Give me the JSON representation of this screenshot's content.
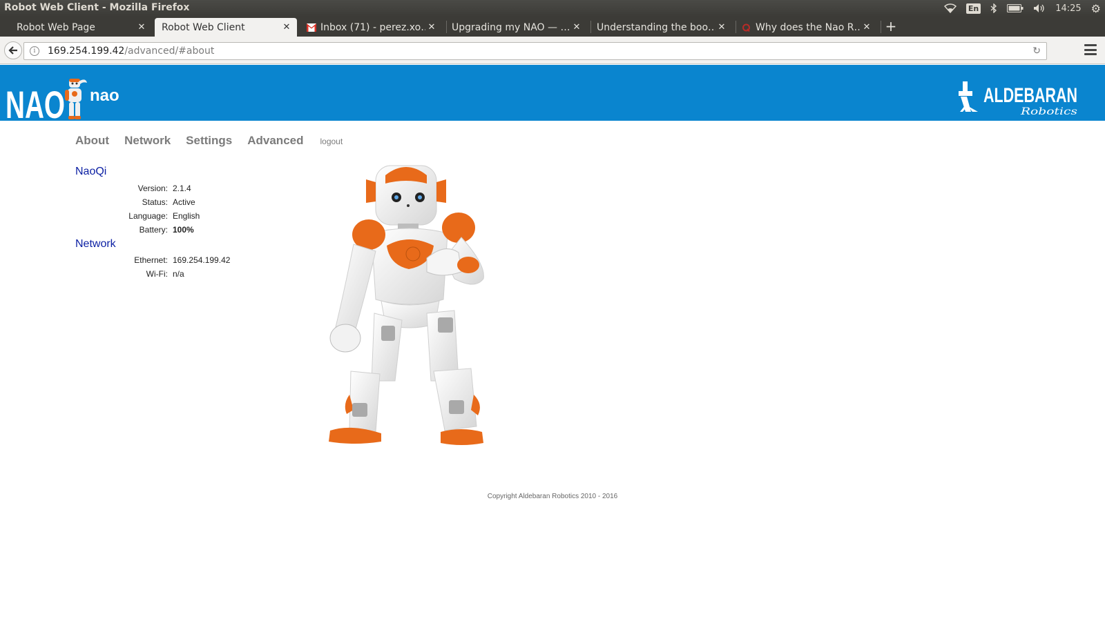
{
  "window": {
    "title": "Robot Web Client - Mozilla Firefox",
    "tray": {
      "lang": "En",
      "time": "14:25"
    }
  },
  "tabs": [
    {
      "label": "Robot Web Page",
      "active": false
    },
    {
      "label": "Robot Web Client",
      "active": true
    },
    {
      "label": "Inbox (71) - perez.xo…",
      "active": false
    },
    {
      "label": "Upgrading my NAO — …",
      "active": false
    },
    {
      "label": "Understanding the boo…",
      "active": false
    },
    {
      "label": "Why does the Nao R…",
      "active": false
    }
  ],
  "address_bar": {
    "host": "169.254.199.42",
    "path": "/advanced/#about"
  },
  "header": {
    "logo_text": "NAO",
    "robot_name": "nao",
    "brand": "ALDEBARAN",
    "brand_sub": "Robotics"
  },
  "nav": {
    "items": [
      "About",
      "Network",
      "Settings",
      "Advanced"
    ],
    "logout": "logout"
  },
  "naoqi": {
    "title": "NaoQi",
    "rows": [
      {
        "label": "Version:",
        "value": "2.1.4"
      },
      {
        "label": "Status:",
        "value": "Active"
      },
      {
        "label": "Language:",
        "value": "English"
      },
      {
        "label": "Battery:",
        "value": "100%"
      }
    ]
  },
  "network": {
    "title": "Network",
    "rows": [
      {
        "label": "Ethernet:",
        "value": "169.254.199.42"
      },
      {
        "label": "Wi-Fi:",
        "value": "n/a"
      }
    ]
  },
  "footer": {
    "copyright": "Copyright Aldebaran Robotics 2010 - 2016"
  },
  "colors": {
    "banner": "#0a85cf",
    "section_title": "#0b1fa3",
    "robot_accent": "#e86a1a"
  }
}
